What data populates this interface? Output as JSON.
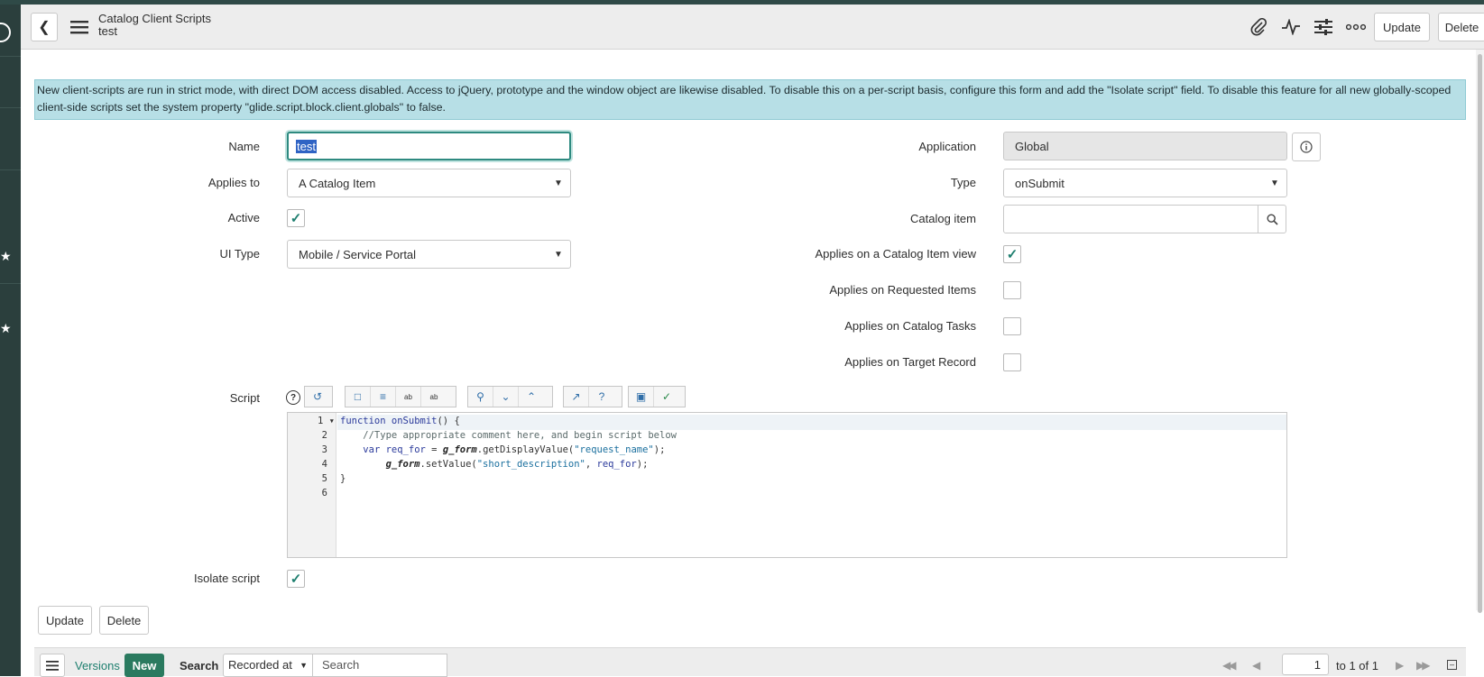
{
  "header": {
    "title": "Catalog Client Scripts",
    "subtitle": "test",
    "update_label": "Update",
    "delete_label": "Delete",
    "icons": [
      "back-icon",
      "menu-icon",
      "paperclip-icon",
      "activity-icon",
      "sliders-icon",
      "more-icon"
    ]
  },
  "banner": {
    "text": "New client-scripts are run in strict mode, with direct DOM access disabled. Access to jQuery, prototype and the window object are likewise disabled. To disable this on a per-script basis, configure this form and add the \"Isolate script\" field. To disable this feature for all new globally-scoped client-side scripts set the system property \"glide.script.block.client.globals\" to false."
  },
  "form": {
    "name_label": "Name",
    "name_value": "test",
    "applies_to_label": "Applies to",
    "applies_to_value": "A Catalog Item",
    "active_label": "Active",
    "active_checked": true,
    "ui_type_label": "UI Type",
    "ui_type_value": "Mobile / Service Portal",
    "application_label": "Application",
    "application_value": "Global",
    "type_label": "Type",
    "type_value": "onSubmit",
    "catalog_item_label": "Catalog item",
    "catalog_item_value": "",
    "applies_view_label": "Applies on a Catalog Item view",
    "applies_view_checked": true,
    "applies_requested_label": "Applies on Requested Items",
    "applies_requested_checked": false,
    "applies_tasks_label": "Applies on Catalog Tasks",
    "applies_tasks_checked": false,
    "applies_target_label": "Applies on Target Record",
    "applies_target_checked": false,
    "script_label": "Script",
    "isolate_label": "Isolate script",
    "isolate_checked": true
  },
  "script": {
    "line_numbers": [
      "1",
      "2",
      "3",
      "4",
      "5",
      "6"
    ],
    "lines": [
      "function onSubmit() {",
      "    //Type appropriate comment here, and begin script below",
      "    var req_for = g_form.getDisplayValue(\"request_name\");",
      "        g_form.setValue(\"short_description\", req_for);",
      "}",
      ""
    ],
    "toolbar_icons": [
      "help-icon",
      "toggle-syntax-icon",
      "comment-icon",
      "format-icon",
      "replace-icon",
      "replace-all-icon",
      "search-icon",
      "fold-down-icon",
      "fold-up-icon",
      "fullscreen-icon",
      "script-help-icon",
      "save-icon",
      "check-syntax-icon"
    ]
  },
  "actions": {
    "update_label": "Update",
    "delete_label": "Delete"
  },
  "related": {
    "tab_label": "Versions",
    "new_label": "New",
    "search_label": "Search",
    "search_field_value": "Recorded at",
    "search_placeholder": "Search",
    "page_value": "1",
    "page_text": "to 1 of 1"
  },
  "colors": {
    "accent": "#1e7f6f",
    "banner": "#b7dfe6",
    "sidebar": "#2b3f3d",
    "new_button": "#2a7a5f"
  }
}
